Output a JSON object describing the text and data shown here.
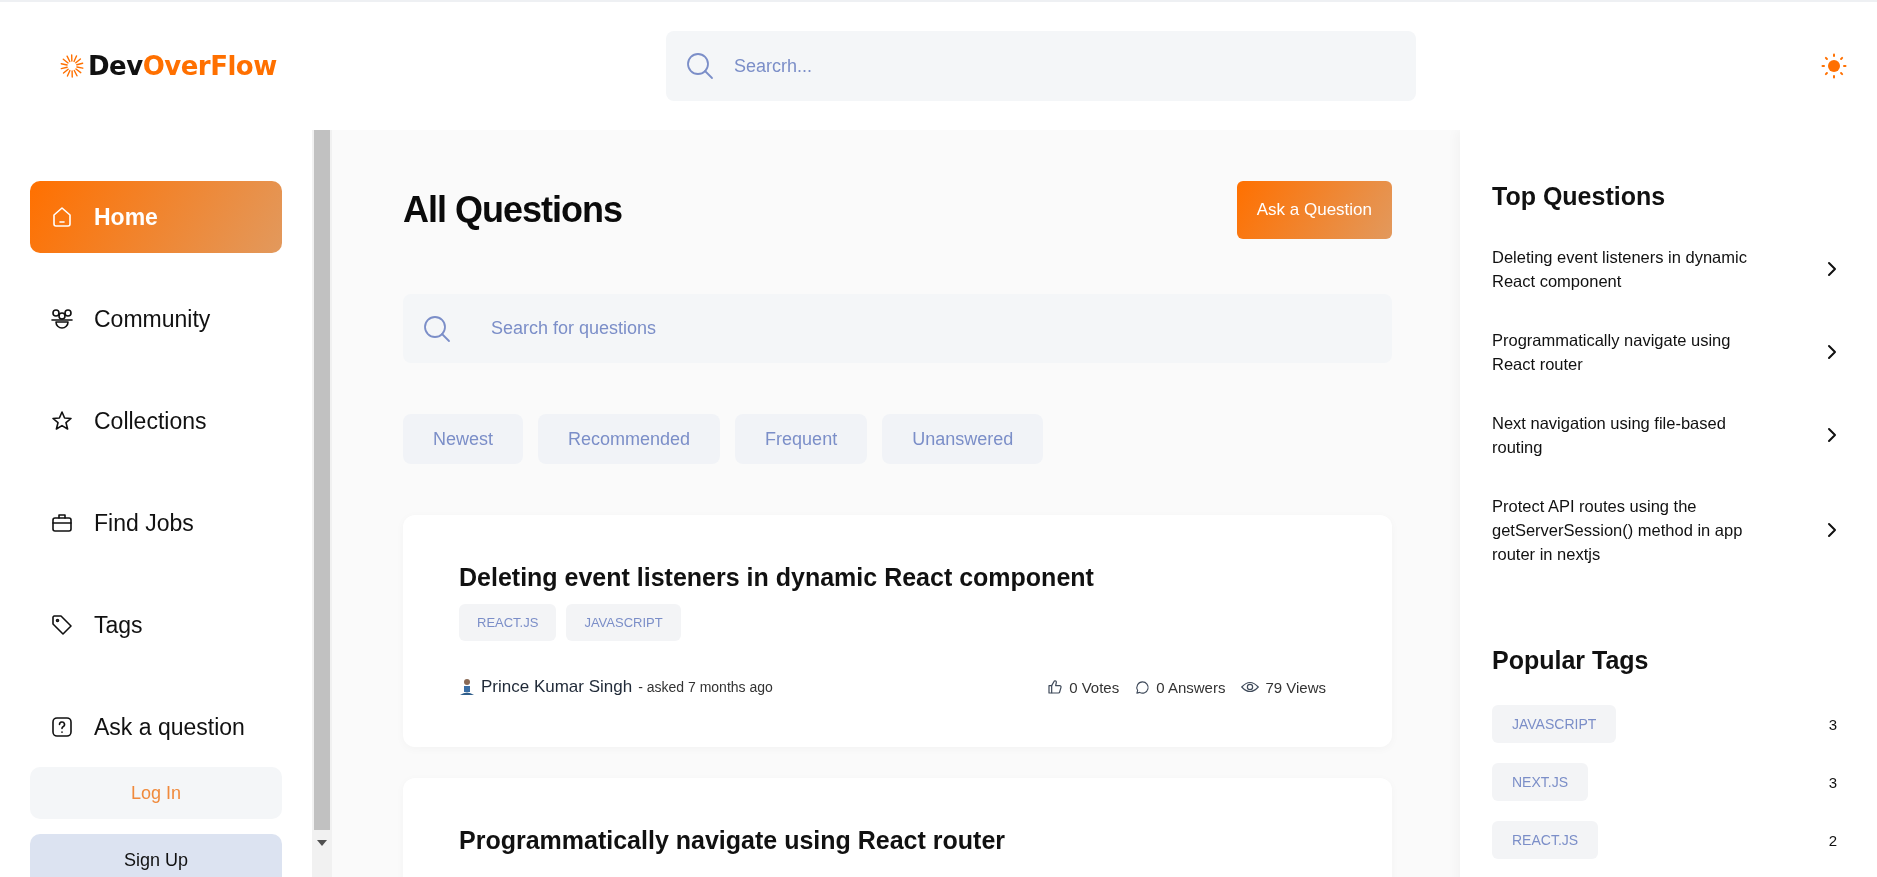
{
  "header": {
    "logo": {
      "prefix": "Dev",
      "suffix": "OverFlow"
    },
    "search": {
      "placeholder": "Searcrh..."
    }
  },
  "sidebar": {
    "items": [
      {
        "label": "Home",
        "kind": "home",
        "selected": true
      },
      {
        "label": "Community",
        "kind": "community",
        "selected": false
      },
      {
        "label": "Collections",
        "kind": "collections",
        "selected": false
      },
      {
        "label": "Find Jobs",
        "kind": "jobs",
        "selected": false
      },
      {
        "label": "Tags",
        "kind": "tags",
        "selected": false
      },
      {
        "label": "Ask a question",
        "kind": "ask",
        "selected": false
      }
    ],
    "login": "Log In",
    "signup": "Sign Up"
  },
  "main": {
    "title": "All Questions",
    "ask_button": "Ask a Question",
    "search": {
      "placeholder": "Search for questions"
    },
    "filters": [
      {
        "label": "Newest",
        "selected": false
      },
      {
        "label": "Recommended",
        "selected": false
      },
      {
        "label": "Frequent",
        "selected": false
      },
      {
        "label": "Unanswered",
        "selected": false
      }
    ],
    "questions": [
      {
        "title": "Deleting event listeners in dynamic React component",
        "tags": [
          "REACT.JS",
          "JAVASCRIPT"
        ],
        "author": "Prince Kumar Singh",
        "asked": "- asked 7 months ago",
        "votes": "0 Votes",
        "answers": "0 Answers",
        "views": "79 Views"
      },
      {
        "title": "Programmatically navigate using React router"
      }
    ]
  },
  "right_sidebar": {
    "top_title": "Top Questions",
    "top_questions": [
      "Deleting event listeners in dynamic React component",
      "Programmatically navigate using React router",
      "Next navigation using file-based routing",
      "Protect API routes using the getServerSession() method in app router in nextjs"
    ],
    "tags_title": "Popular Tags",
    "tags": [
      {
        "name": "JAVASCRIPT",
        "count": "3"
      },
      {
        "name": "NEXT.JS",
        "count": "3"
      },
      {
        "name": "REACT.JS",
        "count": "2"
      }
    ]
  }
}
